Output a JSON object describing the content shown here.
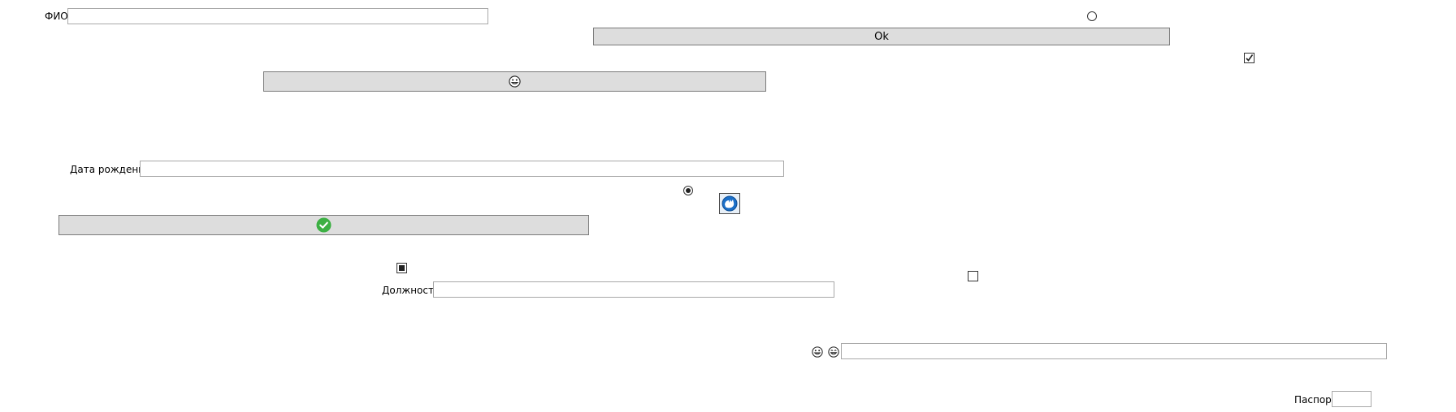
{
  "form": {
    "fio_label": "ФИО",
    "fio_value": "",
    "birthdate_label": "Дата рождения",
    "birthdate_value": "",
    "position_label": "Должность",
    "position_value": "",
    "passport_label": "Паспорт",
    "passport_value": "",
    "emoji_field_value": ""
  },
  "buttons": {
    "ok_label": "Ok",
    "emoji_button_icon": "grinning-face-icon",
    "check_button_icon": "green-check-icon",
    "image_button_icon": "blue-round-logo-icon"
  },
  "toggles": {
    "radio_top_selected": false,
    "radio_middle_selected": true,
    "checkbox_top_checked": true,
    "checkbox_left_state": "indeterminate",
    "checkbox_right_checked": false
  },
  "colors": {
    "button_bg": "#dddddd",
    "check_green": "#3cb043",
    "logo_blue": "#1b6fc8"
  }
}
